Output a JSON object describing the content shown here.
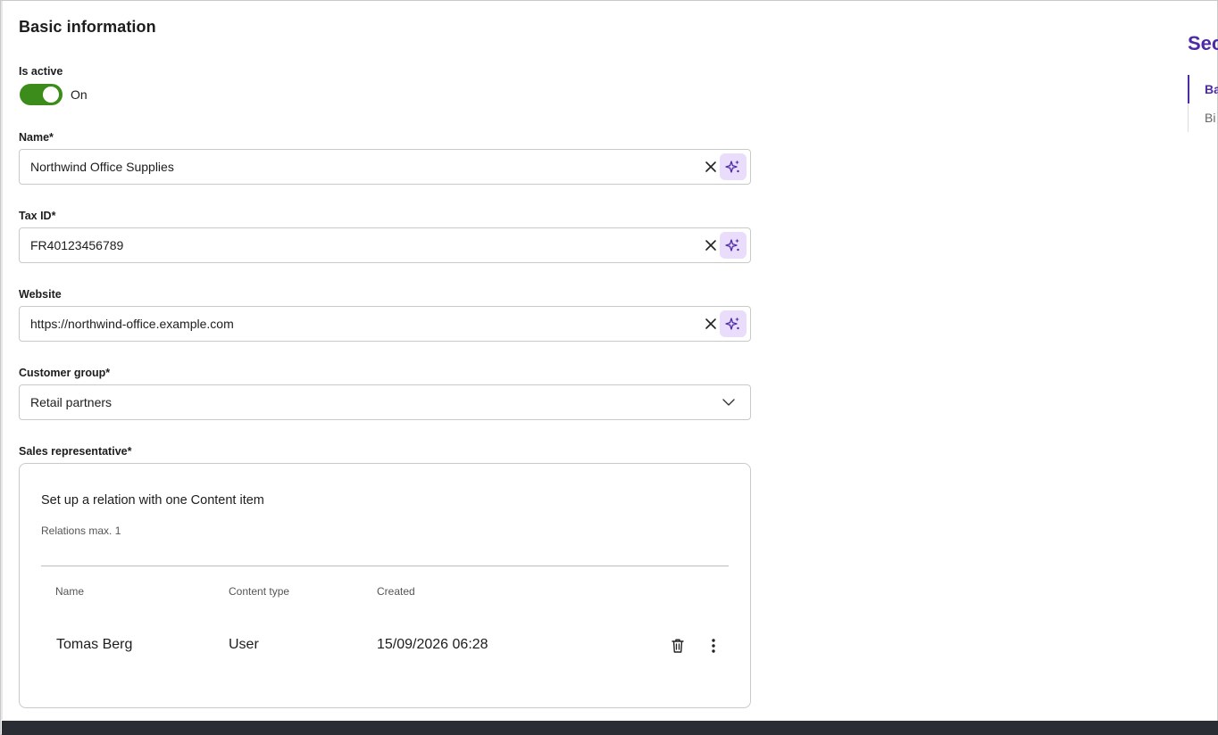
{
  "form": {
    "section_title": "Basic information",
    "is_active": {
      "label": "Is active",
      "state_text": "On",
      "checked": true
    },
    "name": {
      "label": "Name*",
      "value": "Northwind Office Supplies"
    },
    "tax_id": {
      "label": "Tax ID*",
      "value": "FR40123456789"
    },
    "website": {
      "label": "Website",
      "value": "https://northwind-office.example.com"
    },
    "customer_group": {
      "label": "Customer group*",
      "selected": "Retail partners"
    },
    "sales_rep": {
      "label": "Sales representative*",
      "title": "Set up a relation with one Content item",
      "subtitle": "Relations max. 1",
      "columns": [
        "Name",
        "Content type",
        "Created"
      ],
      "rows": [
        {
          "name": "Tomas Berg",
          "content_type": "User",
          "created": "15/09/2026 06:28"
        }
      ]
    }
  },
  "toc": {
    "title": "Sec",
    "items": [
      {
        "label": "Ba",
        "active": true
      },
      {
        "label": "Bi",
        "active": false
      }
    ]
  },
  "icons": {
    "clear": "close-icon",
    "ai": "sparkle-icon",
    "dropdown": "chevron-down-icon",
    "delete": "trash-icon",
    "more": "kebab-menu-icon"
  },
  "colors": {
    "accent": "#4f2aa7",
    "toggle_on": "#3b8c1a",
    "ai_button_bg": "#e9ddfb",
    "border": "#c9c9c9",
    "footer": "#2a2d33"
  }
}
